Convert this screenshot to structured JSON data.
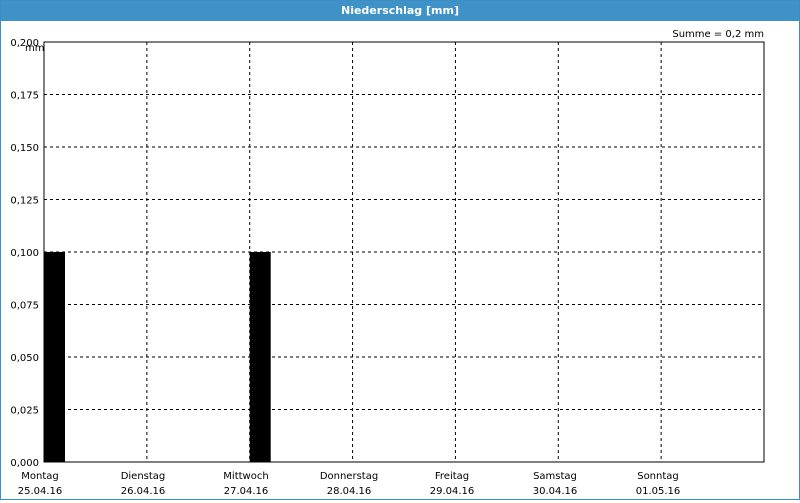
{
  "window": {
    "title": "Niederschlag [mm]"
  },
  "colors": {
    "titlebar": "#3f92c8",
    "bar": "#000000",
    "grid": "#000000"
  },
  "chart_data": {
    "type": "bar",
    "title": "Niederschlag [mm]",
    "ylabel": "mm",
    "xlabel": "",
    "summary": "Summe = 0,2 mm",
    "ylim": [
      0,
      0.2
    ],
    "yticks": [
      0,
      0.025,
      0.05,
      0.075,
      0.1,
      0.125,
      0.15,
      0.175,
      0.2
    ],
    "ytick_labels": [
      "0,000",
      "0,025",
      "0,050",
      "0,075",
      "0,100",
      "0,125",
      "0,150",
      "0,175",
      "0,200"
    ],
    "grid": true,
    "categories": [
      {
        "day": "Montag",
        "date": "25.04.16"
      },
      {
        "day": "Dienstag",
        "date": "26.04.16"
      },
      {
        "day": "Mittwoch",
        "date": "27.04.16"
      },
      {
        "day": "Donnerstag",
        "date": "28.04.16"
      },
      {
        "day": "Freitag",
        "date": "29.04.16"
      },
      {
        "day": "Samstag",
        "date": "30.04.16"
      },
      {
        "day": "Sonntag",
        "date": "01.05.16"
      }
    ],
    "values": [
      0.1,
      0,
      0.1,
      0,
      0,
      0,
      0
    ]
  }
}
